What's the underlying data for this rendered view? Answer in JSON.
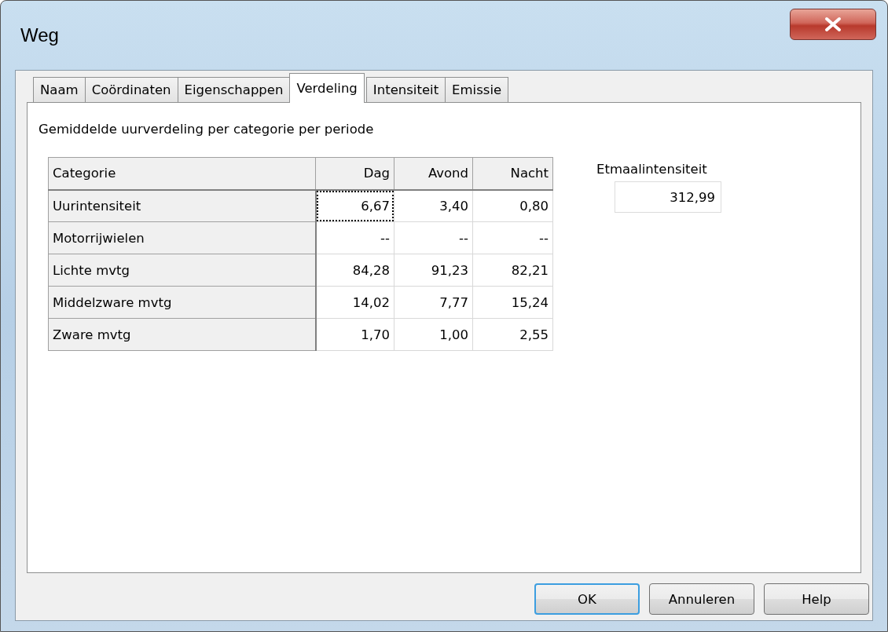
{
  "window": {
    "title": "Weg"
  },
  "tabs": [
    {
      "label": "Naam",
      "selected": false
    },
    {
      "label": "Coördinaten",
      "selected": false
    },
    {
      "label": "Eigenschappen",
      "selected": false
    },
    {
      "label": "Verdeling",
      "selected": true
    },
    {
      "label": "Intensiteit",
      "selected": false
    },
    {
      "label": "Emissie",
      "selected": false
    }
  ],
  "panel": {
    "heading": "Gemiddelde uurverdeling per categorie per periode",
    "table": {
      "columns": [
        "Categorie",
        "Dag",
        "Avond",
        "Nacht"
      ],
      "rows": [
        {
          "cells": [
            {
              "kind": "header",
              "text": "Uurintensiteit"
            },
            {
              "text": "6,67",
              "focused": true
            },
            {
              "text": "3,40",
              "focused": false
            },
            {
              "text": "0,80",
              "focused": false
            }
          ]
        },
        {
          "cells": [
            {
              "kind": "header",
              "text": "Motorrijwielen"
            },
            {
              "text": "--",
              "focused": false
            },
            {
              "text": "--",
              "focused": false
            },
            {
              "text": "--",
              "focused": false
            }
          ]
        },
        {
          "cells": [
            {
              "kind": "header",
              "text": "Lichte mvtg"
            },
            {
              "text": "84,28",
              "focused": false
            },
            {
              "text": "91,23",
              "focused": false
            },
            {
              "text": "82,21",
              "focused": false
            }
          ]
        },
        {
          "cells": [
            {
              "kind": "header",
              "text": "Middelzware mvtg"
            },
            {
              "text": "14,02",
              "focused": false
            },
            {
              "text": "7,77",
              "focused": false
            },
            {
              "text": "15,24",
              "focused": false
            }
          ]
        },
        {
          "cells": [
            {
              "kind": "header",
              "text": "Zware mvtg"
            },
            {
              "text": "1,70",
              "focused": false
            },
            {
              "text": "1,00",
              "focused": false
            },
            {
              "text": "2,55",
              "focused": false
            }
          ]
        }
      ]
    },
    "etmaal": {
      "label": "Etmaalintensiteit",
      "value": "312,99"
    }
  },
  "buttons": [
    {
      "label": "OK",
      "default": true
    },
    {
      "label": "Annuleren",
      "default": false
    },
    {
      "label": "Help",
      "default": false
    }
  ]
}
